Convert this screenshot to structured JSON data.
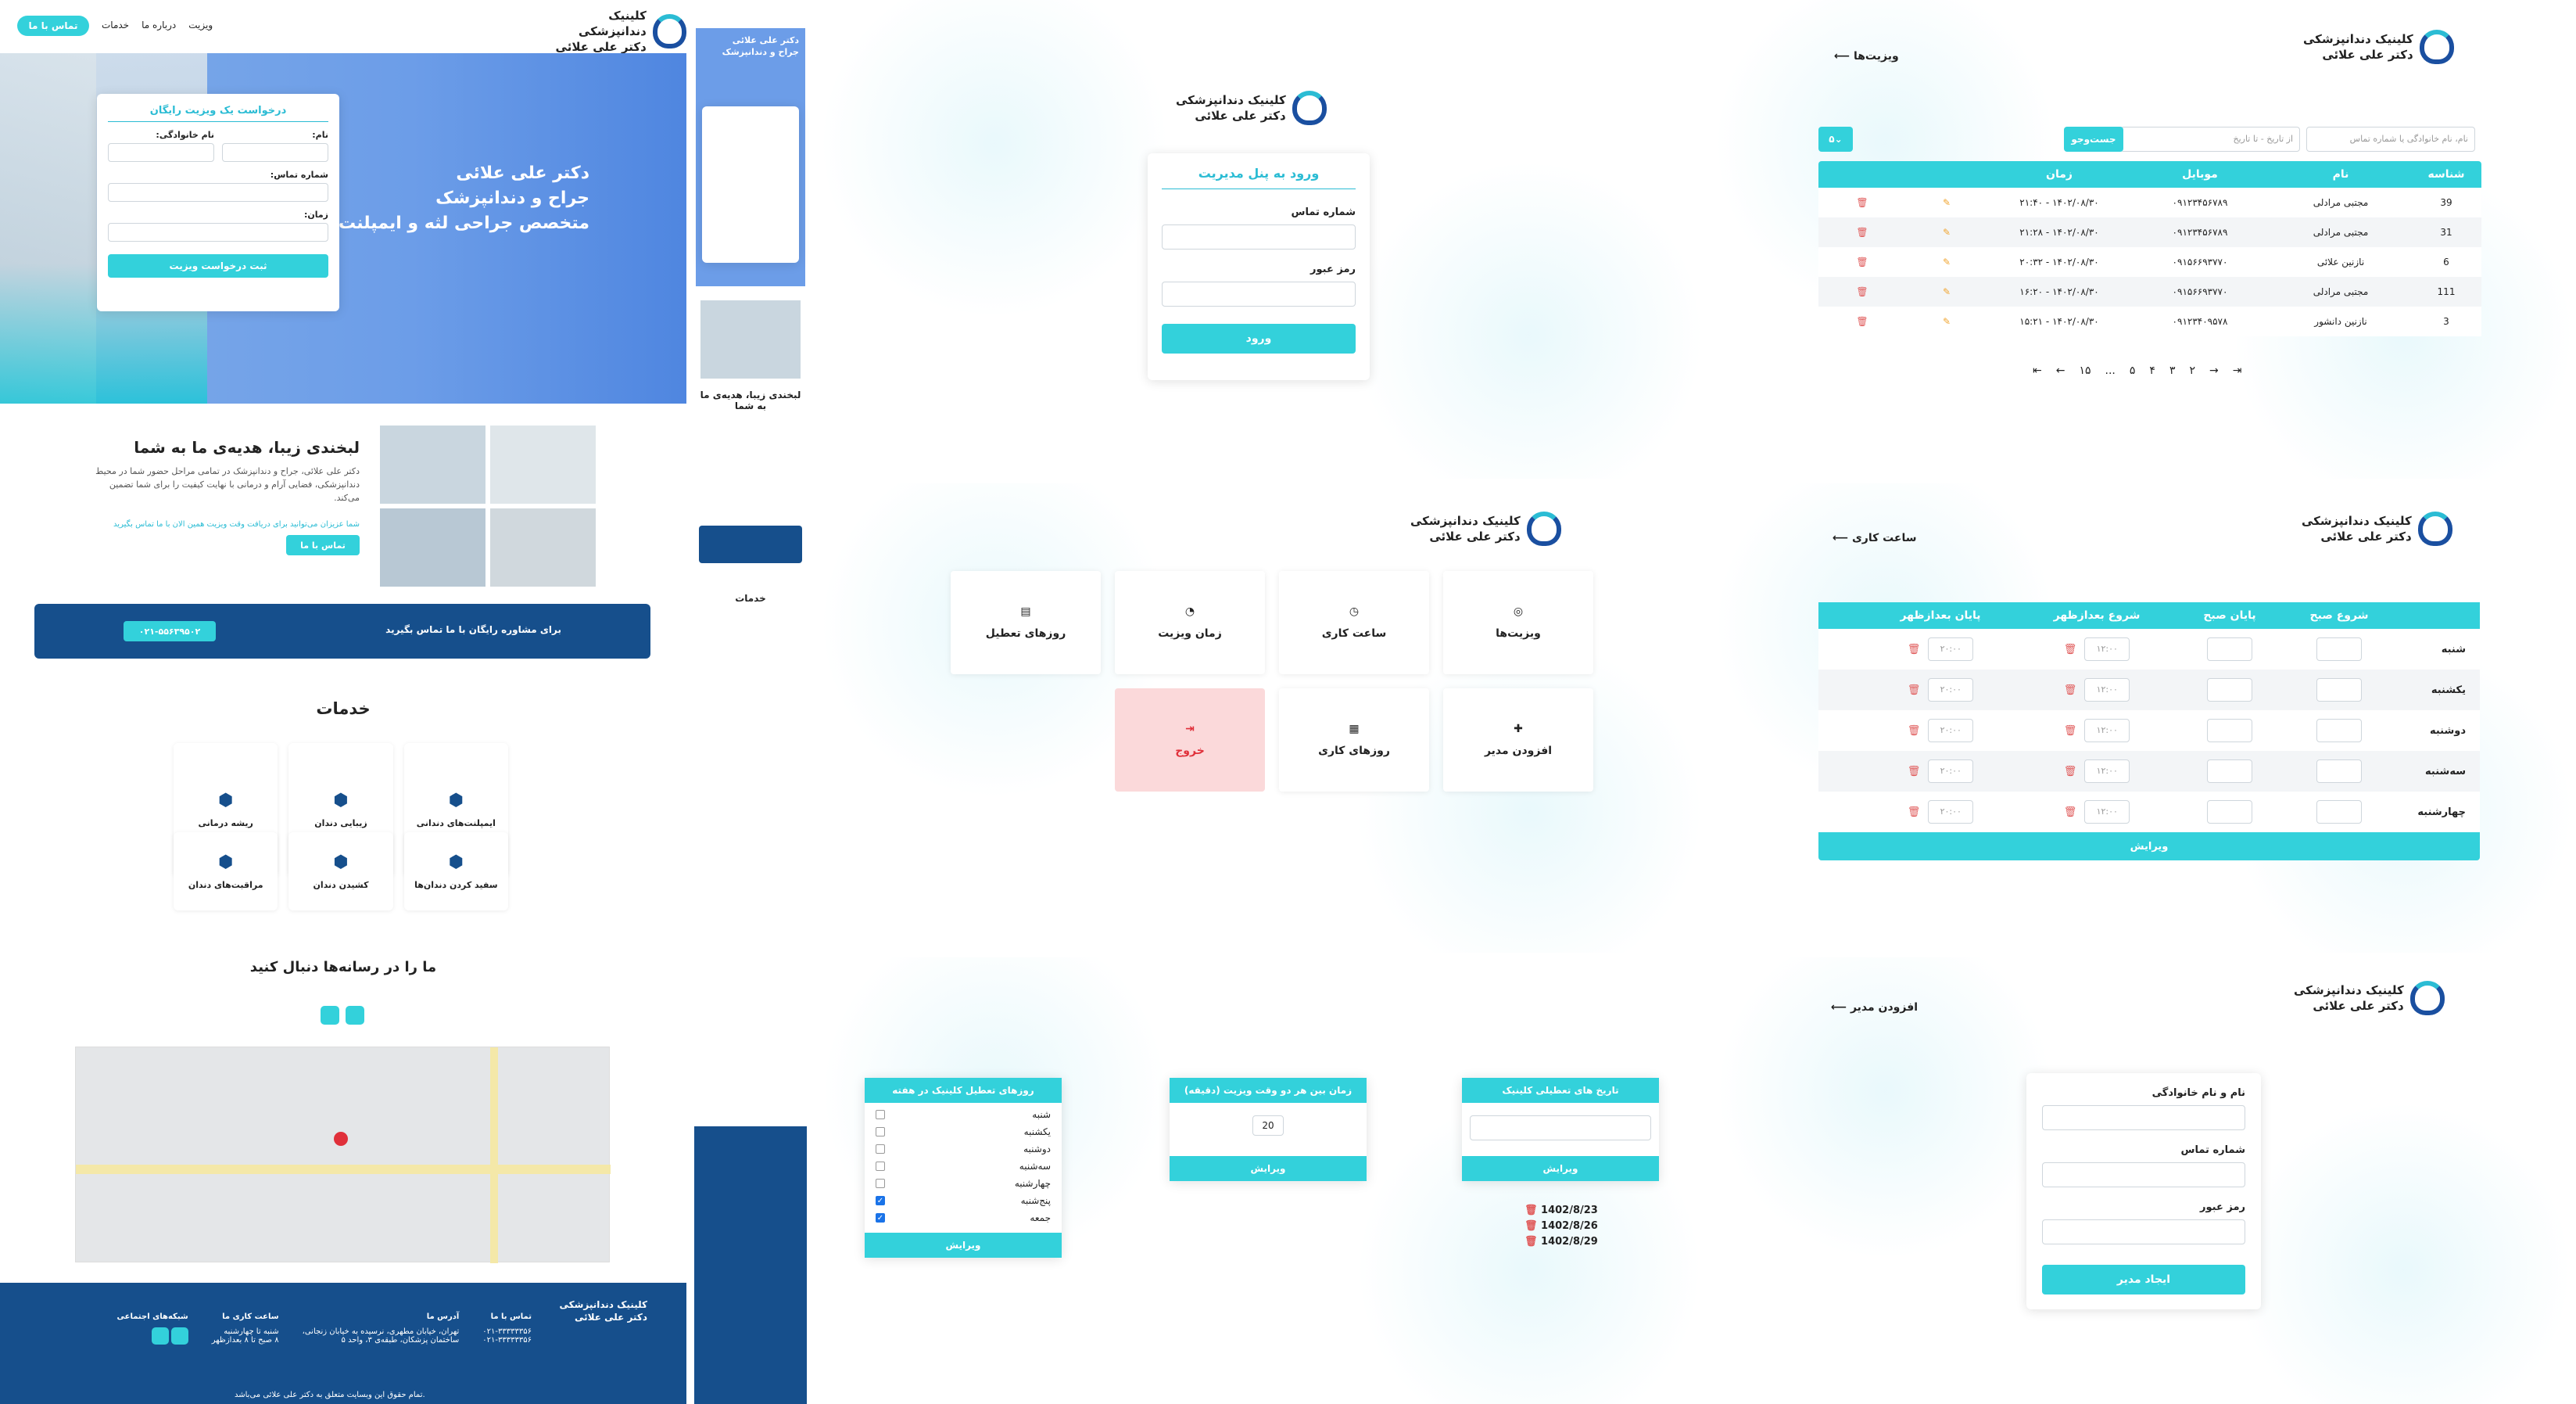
{
  "clinic": {
    "name_line1": "کلینیک دندانپزشکی",
    "name_line2": "دکتر علی علائی"
  },
  "landing": {
    "nav": {
      "contact_btn": "تماس با ما",
      "items": [
        "خدمات",
        "درباره ما",
        "ویزیت"
      ]
    },
    "hero": {
      "title_lines": [
        "دکتر علی علائی",
        "جراح و دندانپزشک",
        "متخصص جراحی لثه و ایمپلنت"
      ],
      "form": {
        "title": "درخواست یک ویزیت رایگان",
        "name_label": "نام:",
        "family_label": "نام خانوادگی:",
        "phone_label": "شماره تماس:",
        "time_label": "زمان:",
        "submit": "ثبت درخواست ویزیت"
      }
    },
    "about": {
      "title": "لبخندی زیبا، هدیه‌ی ما به شما",
      "body": "دکتر علی علائی، جراح و دندانپزشک در تمامی مراحل حضور شما در محیط دندانپزشکی، فضایی آرام و درمانی با نهایت کیفیت را برای شما تضمین می‌کند.",
      "link": "شما عزیزان می‌توانید برای دریافت وقت ویزیت همین الان با ما تماس بگیرید",
      "call_btn": "تماس با ما"
    },
    "banner": {
      "text": "برای مشاوره رایگان با ما تماس بگیرید",
      "phone": "۰۲۱-۵۵۶۳۹۵۰۲"
    },
    "services": {
      "title": "خدمات",
      "items": [
        "ایمپلنت‌های دندانی",
        "زیبایی دندان",
        "ریشه درمانی",
        "سفید کردن دندان‌ها",
        "کشیدن دندان",
        "مراقبت‌های دندان"
      ]
    },
    "social": {
      "title": "ما را در رسانه‌ها دنبال کنید"
    },
    "footer": {
      "cols": [
        {
          "title": "تماس با ما",
          "lines": [
            "۰۲۱-۳۳۳۳۳۳۵۶",
            "۰۲۱-۳۳۳۳۳۳۵۶"
          ]
        },
        {
          "title": "آدرس ما",
          "lines": [
            "تهران، خیابان مطهری، نرسیده به خیابان زنجانی،",
            "ساختمان پزشکان، طبقه‌ی ۳، واحد ۵"
          ]
        },
        {
          "title": "ساعت کاری ما",
          "lines": [
            "شنبه تا چهارشنبه",
            "۸ صبح تا ۸ بعدازظهر"
          ]
        },
        {
          "title": "شبکه‌های اجتماعی",
          "lines": []
        }
      ],
      "copyright": "تمام حقوق این وبسایت متعلق به دکتر علی علائی می‌باشد."
    }
  },
  "login": {
    "title": "ورود به پنل مدیریت",
    "phone_label": "شماره تماس",
    "password_label": "رمز عبور",
    "submit": "ورود"
  },
  "visits": {
    "back": "ویزیت‌ها",
    "search_placeholder": "نام، نام خانوادگی یا شماره تماس",
    "date_placeholder": "از تاریخ - تا تاریخ",
    "search_btn": "جست‌وجو",
    "per_page": "۵",
    "headers": [
      "شناسه",
      "نام",
      "موبایل",
      "زمان"
    ],
    "rows": [
      [
        "39",
        "مجتبی مرادلی",
        "۰۹۱۲۳۴۵۶۷۸۹",
        "۱۴۰۲/۰۸/۳۰ - ۲۱:۴۰"
      ],
      [
        "31",
        "مجتبی مرادلی",
        "۰۹۱۲۳۴۵۶۷۸۹",
        "۱۴۰۲/۰۸/۳۰ - ۲۱:۲۸"
      ],
      [
        "6",
        "نازنین علائی",
        "۰۹۱۵۶۶۹۳۷۷۰",
        "۱۴۰۲/۰۸/۳۰ - ۲۰:۳۲"
      ],
      [
        "111",
        "مجتبی مرادلی",
        "۰۹۱۵۶۶۹۳۷۷۰",
        "۱۴۰۲/۰۸/۳۰ - ۱۶:۲۰"
      ],
      [
        "3",
        "نازنین دانشور",
        "۰۹۱۲۳۴۰۹۵۷۸",
        "۱۴۰۲/۰۸/۳۰ - ۱۵:۲۱"
      ]
    ],
    "pages": [
      "۱",
      "۲",
      "۳",
      "۴",
      "۵",
      "...",
      "۱۵"
    ]
  },
  "dashboard": {
    "tiles": [
      "ویزیت‌ها",
      "ساعت کاری",
      "زمان ویزیت",
      "روزهای تعطیل",
      "افزودن مدیر",
      "روزهای کاری",
      "خروج"
    ]
  },
  "hours": {
    "back": "ساعت کاری",
    "headers": [
      "شروع صبح",
      "پایان صبح",
      "شروع بعدازظهر",
      "پایان بعدازظهر"
    ],
    "days": [
      "شنبه",
      "یکشنبه",
      "دوشنبه",
      "سه‌شنبه",
      "چهارشنبه"
    ],
    "pm_start": "۱۲:۰۰",
    "pm_end": "۲۰:۰۰",
    "save": "ویرایش"
  },
  "holidays": {
    "dates_title": "تاریخ های تعطیلی کلینیک",
    "dates": [
      "1402/8/23",
      "1402/8/26",
      "1402/8/29"
    ],
    "interval_title": "زمان بین هر دو وقت ویزیت (دقیقه)",
    "interval": "20",
    "weekdays_title": "روزهای تعطیل کلینیک در هفته",
    "weekdays": [
      "شنبه",
      "یکشنبه",
      "دوشنبه",
      "سه‌شنبه",
      "چهارشنبه",
      "پنج‌شنبه",
      "جمعه"
    ],
    "checked": [
      false,
      false,
      false,
      false,
      false,
      true,
      true
    ],
    "save": "ویرایش"
  },
  "add_admin": {
    "back": "افزودن مدیر",
    "name_label": "نام و نام خانوادگی",
    "phone_label": "شماره تماس",
    "password_label": "رمز عبور",
    "submit": "ایجاد مدیر"
  }
}
